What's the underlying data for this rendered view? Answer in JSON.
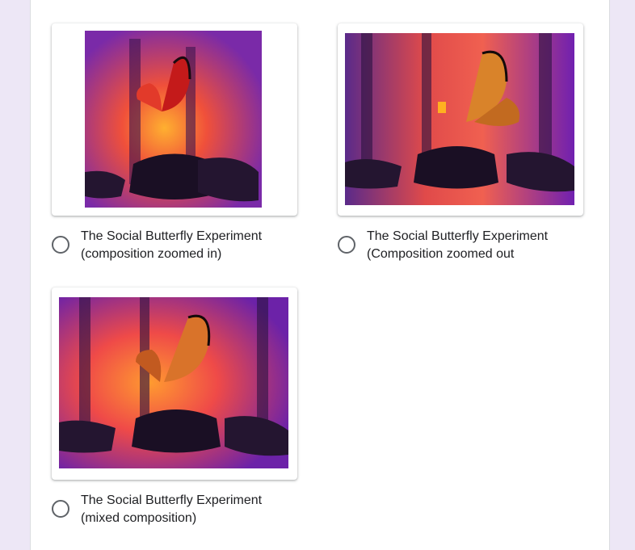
{
  "options": [
    {
      "line1": "The Social Butterfly Experiment",
      "line2": "(composition zoomed in)",
      "image_subject": "butterfly-on-glowing-lantern",
      "selected": false
    },
    {
      "line1": "The Social Butterfly Experiment",
      "line2": "(Composition zoomed out",
      "image_subject": "butterfly-on-glowing-lantern",
      "selected": false
    },
    {
      "line1": "The Social Butterfly Experiment",
      "line2": "(mixed composition)",
      "image_subject": "butterfly-on-glowing-lantern",
      "selected": false
    }
  ],
  "colors": {
    "page_background": "#ede7f6",
    "card_background": "#ffffff",
    "radio_border": "#5f6368",
    "text": "#202124"
  }
}
